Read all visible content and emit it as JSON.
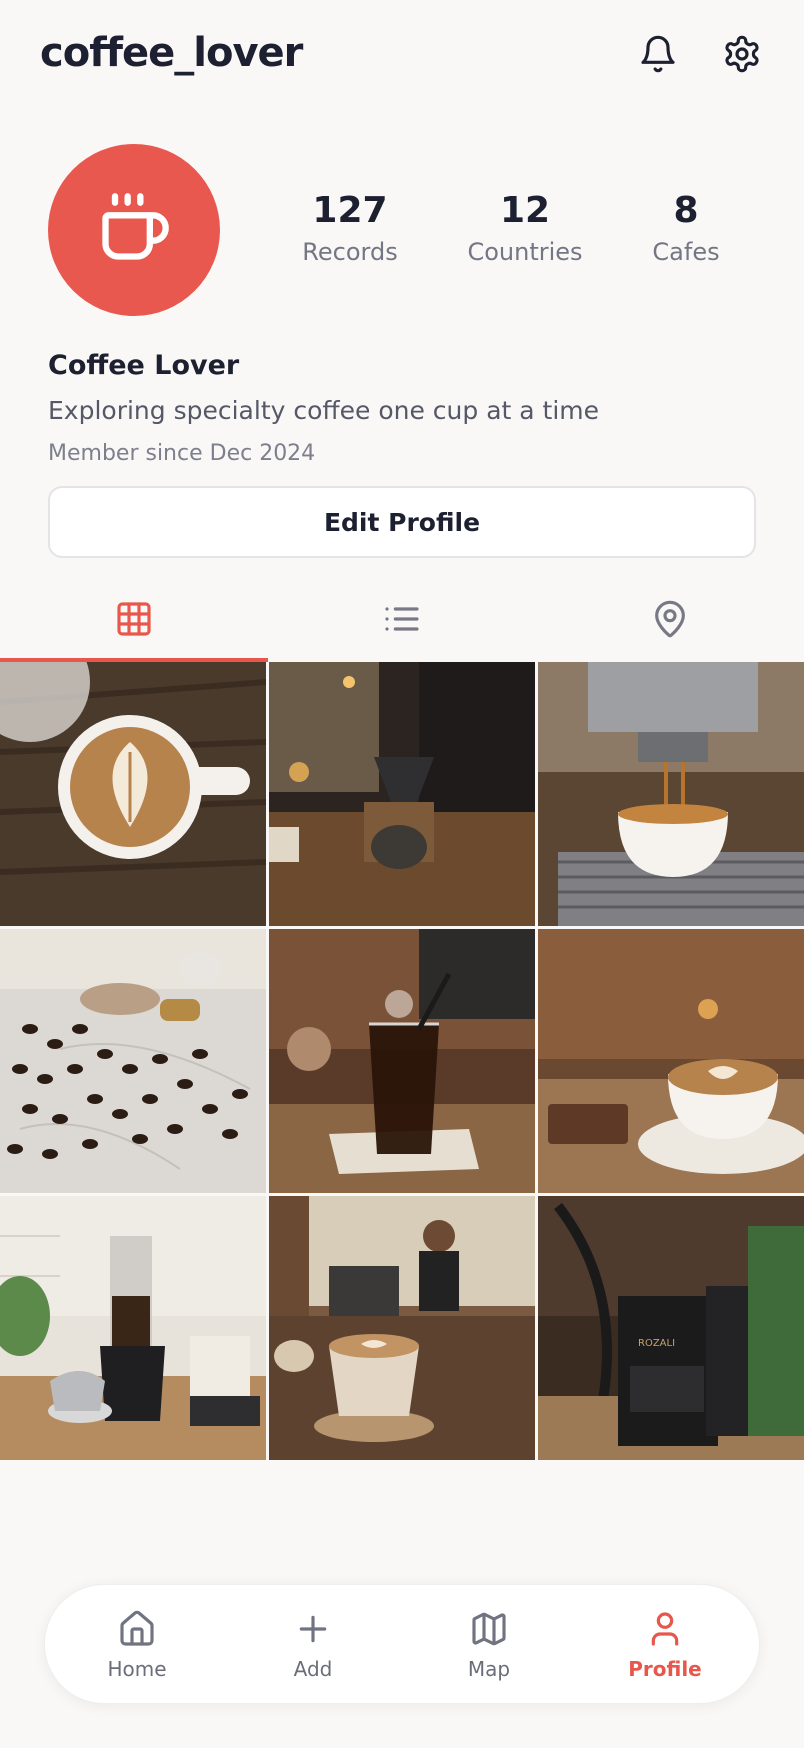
{
  "header": {
    "username": "coffee_lover",
    "icons": [
      "bell-icon",
      "gear-icon"
    ]
  },
  "profile": {
    "avatar_icon": "coffee-cup-icon",
    "avatar_color": "#e8584e",
    "stats": [
      {
        "value": "127",
        "label": "Records"
      },
      {
        "value": "12",
        "label": "Countries"
      },
      {
        "value": "8",
        "label": "Cafes"
      }
    ],
    "display_name": "Coffee Lover",
    "bio": "Exploring specialty coffee one cup at a time",
    "member_since": "Member since Dec 2024",
    "edit_button": "Edit Profile"
  },
  "tabs": {
    "items": [
      "grid-icon",
      "list-icon",
      "map-pin-icon"
    ],
    "active": "grid-icon"
  },
  "grid": {
    "photos": [
      "latte-art-on-wooden-table",
      "pour-over-brewing",
      "espresso-extraction",
      "coffee-beans-on-marble",
      "iced-cold-brew",
      "cappuccino-in-cafe",
      "aeropress-brewing",
      "latte-at-cafe-counter",
      "coffee-bean-bags"
    ]
  },
  "bottom_nav": {
    "items": [
      {
        "label": "Home",
        "icon": "home-icon"
      },
      {
        "label": "Add",
        "icon": "plus-icon"
      },
      {
        "label": "Map",
        "icon": "map-icon"
      },
      {
        "label": "Profile",
        "icon": "user-icon"
      }
    ],
    "active": "Profile"
  },
  "colors": {
    "accent": "#e8574b",
    "background": "#faf8f6",
    "text_primary": "#1c2030",
    "text_secondary": "#737683"
  }
}
